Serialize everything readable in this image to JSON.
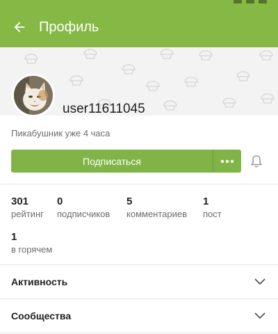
{
  "header": {
    "title": "Профиль",
    "back_icon": "arrow-left-icon",
    "color": "#86b845"
  },
  "profile": {
    "username": "user11611045",
    "since": "Пикабушник уже 4 часа",
    "avatar": "cat-photo"
  },
  "actions": {
    "subscribe_label": "Подписаться",
    "more_icon": "more-dots-icon",
    "bell_icon": "bell-icon",
    "accent": "#80b447"
  },
  "stats": [
    {
      "value": "301",
      "label": "рейтинг"
    },
    {
      "value": "0",
      "label": "подписчиков"
    },
    {
      "value": "5",
      "label": "комментариев"
    },
    {
      "value": "1",
      "label": "пост"
    },
    {
      "value": "1",
      "label": "в горячем"
    }
  ],
  "sections": [
    {
      "label": "Активность",
      "icon": "chevron-down-icon"
    },
    {
      "label": "Сообщества",
      "icon": "chevron-down-icon"
    }
  ]
}
